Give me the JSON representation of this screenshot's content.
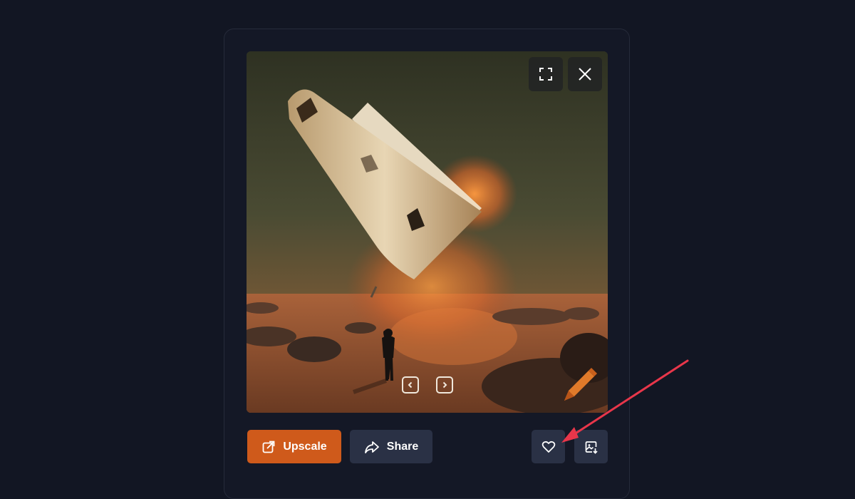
{
  "toolbar": {
    "upscale_label": "Upscale",
    "share_label": "Share"
  },
  "icons": {
    "fullscreen": "fullscreen-icon",
    "close": "close-icon",
    "prev": "chevron-left-icon",
    "next": "chevron-right-icon",
    "edit": "pencil-icon",
    "upscale": "external-arrow-icon",
    "share": "share-arrow-icon",
    "favorite": "heart-icon",
    "save": "image-download-icon"
  },
  "colors": {
    "background": "#121623",
    "card": "#141826",
    "primary_button": "#cf5a1b",
    "secondary_button": "#2a3145",
    "annotation_arrow": "#e8364a"
  }
}
